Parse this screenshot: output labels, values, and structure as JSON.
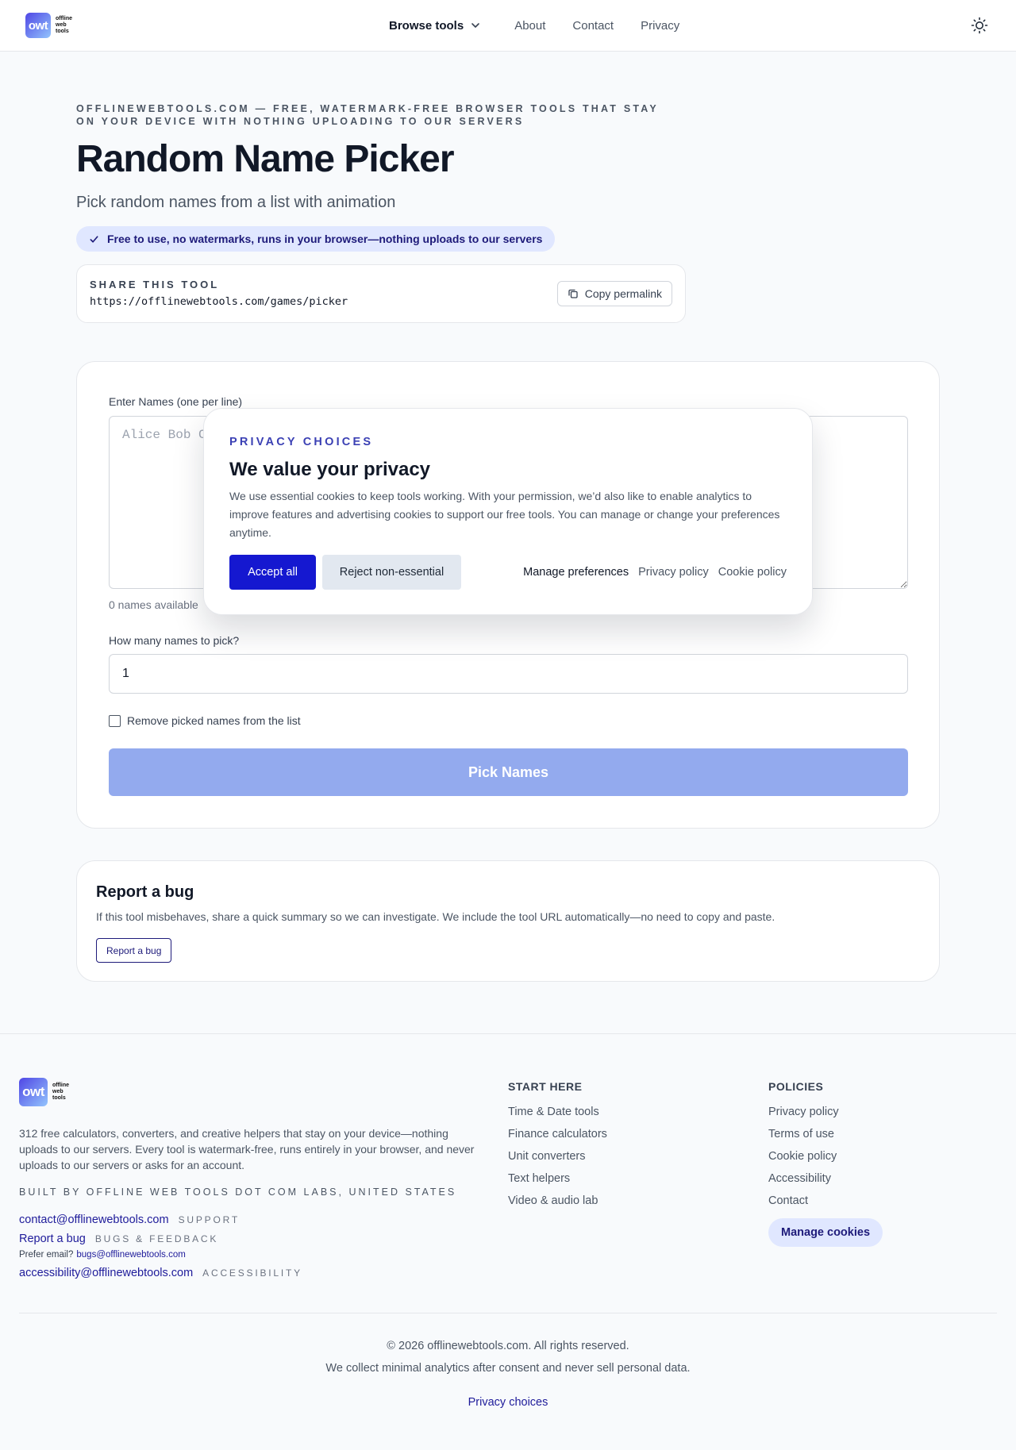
{
  "header": {
    "logo_mark": "owt",
    "logo_words": [
      "offline",
      "web",
      "tools"
    ],
    "nav": {
      "browse": "Browse tools",
      "links": [
        "About",
        "Contact",
        "Privacy"
      ]
    }
  },
  "hero": {
    "eyebrow": "OFFLINEWEBTOOLS.COM — FREE, WATERMARK-FREE BROWSER TOOLS THAT STAY ON YOUR DEVICE WITH NOTHING UPLOADING TO OUR SERVERS",
    "title": "Random Name Picker",
    "subtitle": "Pick random names from a list with animation",
    "badge": "Free to use, no watermarks, runs in your browser—nothing uploads to our servers"
  },
  "share": {
    "label": "SHARE THIS TOOL",
    "url": "https://offlinewebtools.com/games/picker",
    "copy_label": "Copy permalink"
  },
  "tool": {
    "names_label": "Enter Names (one per line)",
    "names_placeholder": "Alice Bob C",
    "count_text": "0 names available",
    "pick_count_label": "How many names to pick?",
    "pick_count_value": "1",
    "remove_label": "Remove picked names from the list",
    "pick_button": "Pick Names"
  },
  "bug": {
    "title": "Report a bug",
    "description": "If this tool misbehaves, share a quick summary so we can investigate. We include the tool URL automatically—no need to copy and paste.",
    "button": "Report a bug"
  },
  "cookie": {
    "eyebrow": "PRIVACY CHOICES",
    "title": "We value your privacy",
    "body": "We use essential cookies to keep tools working. With your permission, we’d also like to enable analytics to improve features and advertising cookies to support our free tools. You can manage or change your preferences anytime.",
    "accept": "Accept all",
    "reject": "Reject non-essential",
    "manage": "Manage preferences",
    "privacy_policy": "Privacy policy",
    "cookie_policy": "Cookie policy"
  },
  "footer": {
    "description": "312 free calculators, converters, and creative helpers that stay on your device—nothing uploads to our servers. Every tool is watermark-free, runs entirely in your browser, and never uploads to our servers or asks for an account.",
    "built_by": "BUILT BY OFFLINE WEB TOOLS DOT COM LABS, UNITED STATES",
    "contact_email": "contact@offlinewebtools.com",
    "contact_tag": "SUPPORT",
    "report_link": "Report a bug",
    "report_tag": "BUGS & FEEDBACK",
    "prefer_email_prefix": "Prefer email?",
    "bugs_email": "bugs@offlinewebtools.com",
    "a11y_email": "accessibility@offlinewebtools.com",
    "a11y_tag": "ACCESSIBILITY",
    "start_here": {
      "heading": "START HERE",
      "links": [
        "Time & Date tools",
        "Finance calculators",
        "Unit converters",
        "Text helpers",
        "Video & audio lab"
      ]
    },
    "policies": {
      "heading": "POLICIES",
      "links": [
        "Privacy policy",
        "Terms of use",
        "Cookie policy",
        "Accessibility",
        "Contact"
      ],
      "manage_cookies": "Manage cookies"
    },
    "copyright": "© 2026 offlinewebtools.com. All rights reserved.",
    "analytics_note": "We collect minimal analytics after consent and never sell personal data.",
    "privacy_choices": "Privacy choices"
  },
  "colors": {
    "accent": "#1518d0",
    "accent_soft": "#e0e7ff",
    "disabled_button": "#93aaee"
  },
  "icons": {
    "theme": "sun-icon",
    "browse": "chevron-down-icon",
    "badge": "check-icon",
    "copy": "copy-icon"
  }
}
